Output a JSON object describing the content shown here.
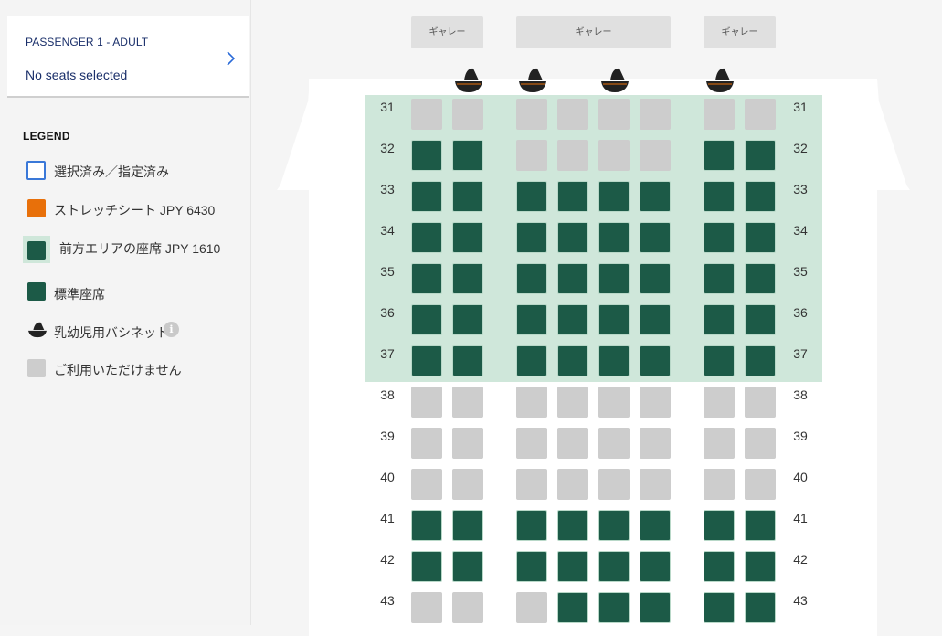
{
  "passenger": {
    "label": "PASSENGER 1 - ADULT",
    "status": "No seats selected"
  },
  "legend": {
    "title": "LEGEND",
    "items": [
      {
        "label": "選択済み／指定済み",
        "type": "selected",
        "color": "#3a78d8"
      },
      {
        "label": "ストレッチシート JPY 6430",
        "type": "stretch",
        "color": "#e8700a"
      },
      {
        "label": "前方エリアの座席 JPY 1610",
        "type": "front",
        "color": "#1c5a47"
      },
      {
        "label": "標準座席",
        "type": "standard",
        "color": "#1c5a47"
      },
      {
        "label": "乳幼児用バシネット",
        "type": "bassinet",
        "icon": "bassinet-icon"
      },
      {
        "label": "ご利用いただけません",
        "type": "unavailable",
        "color": "#cdcdcd"
      }
    ]
  },
  "galleys": [
    "ギャレー",
    "ギャレー",
    "ギャレー"
  ],
  "colors": {
    "available": "#1c5a47",
    "unavailable": "#cdcdcd",
    "front_zone": "#cfe7da"
  },
  "rows": [
    {
      "number": "31",
      "seats": [
        "u",
        "u",
        "u",
        "u",
        "u",
        "u",
        "u",
        "u"
      ]
    },
    {
      "number": "32",
      "seats": [
        "a",
        "a",
        "u",
        "u",
        "u",
        "u",
        "a",
        "a"
      ]
    },
    {
      "number": "33",
      "seats": [
        "a",
        "a",
        "a",
        "a",
        "a",
        "a",
        "a",
        "a"
      ]
    },
    {
      "number": "34",
      "seats": [
        "a",
        "a",
        "a",
        "a",
        "a",
        "a",
        "a",
        "a"
      ]
    },
    {
      "number": "35",
      "seats": [
        "a",
        "a",
        "a",
        "a",
        "a",
        "a",
        "a",
        "a"
      ]
    },
    {
      "number": "36",
      "seats": [
        "a",
        "a",
        "a",
        "a",
        "a",
        "a",
        "a",
        "a"
      ]
    },
    {
      "number": "37",
      "seats": [
        "a",
        "a",
        "a",
        "a",
        "a",
        "a",
        "a",
        "a"
      ]
    },
    {
      "number": "38",
      "seats": [
        "u",
        "u",
        "u",
        "u",
        "u",
        "u",
        "u",
        "u"
      ]
    },
    {
      "number": "39",
      "seats": [
        "u",
        "u",
        "u",
        "u",
        "u",
        "u",
        "u",
        "u"
      ]
    },
    {
      "number": "40",
      "seats": [
        "u",
        "u",
        "u",
        "u",
        "u",
        "u",
        "u",
        "u"
      ]
    },
    {
      "number": "41",
      "seats": [
        "a",
        "a",
        "a",
        "a",
        "a",
        "a",
        "a",
        "a"
      ]
    },
    {
      "number": "42",
      "seats": [
        "a",
        "a",
        "a",
        "a",
        "a",
        "a",
        "a",
        "a"
      ]
    },
    {
      "number": "43",
      "seats": [
        "u",
        "u",
        "u",
        "a",
        "a",
        "a",
        "a",
        "a"
      ]
    }
  ]
}
